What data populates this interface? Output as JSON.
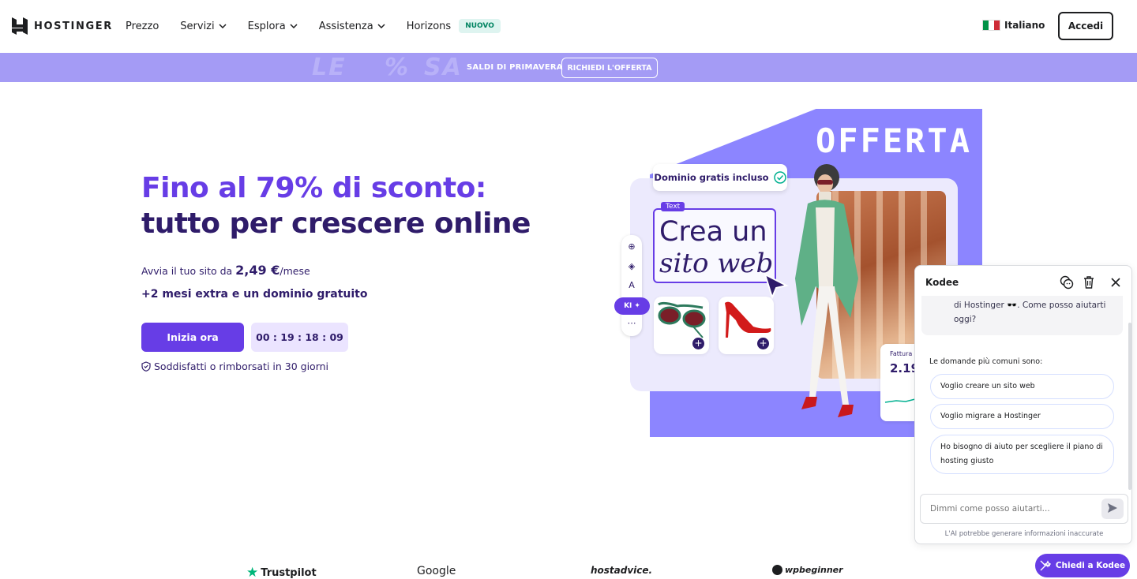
{
  "header": {
    "brand": "HOSTINGER",
    "nav": [
      {
        "label": "Prezzo",
        "dropdown": false
      },
      {
        "label": "Servizi",
        "dropdown": true
      },
      {
        "label": "Esplora",
        "dropdown": true
      },
      {
        "label": "Assistenza",
        "dropdown": true
      },
      {
        "label": "Horizons",
        "dropdown": false,
        "badge": "NUOVO"
      }
    ],
    "language": "Italiano",
    "login": "Accedi"
  },
  "promo": {
    "text": "SALDI DI PRIMAVERA",
    "cta": "RICHIEDI L'OFFERTA"
  },
  "hero": {
    "title_line1": "Fino al 79% di sconto:",
    "title_line2": "tutto per crescere online",
    "price_prefix": "Avvia il tuo sito da",
    "price": "2,49 €",
    "price_suffix": "/mese",
    "extra": "+2 mesi extra e un dominio gratuito",
    "cta": "Inizia ora",
    "timer": "00 : 19 : 18 : 09",
    "guarantee": "Soddisfatti o rimborsati in 30 giorni"
  },
  "illustration": {
    "offer_word": "OFFERTA",
    "domain_pill": "Dominio gratis incluso",
    "text_tag": "Text",
    "headline1": "Crea un",
    "headline2": "sito web",
    "ai_label": "KI",
    "invoice_label": "Fattura",
    "invoice_value": "2.19"
  },
  "chat": {
    "title": "Kodee",
    "message": "di Hostinger 🕶️. Come posso aiutarti oggi?",
    "faq_label": "Le domande più comuni sono:",
    "faq": [
      "Voglio creare un sito web",
      "Voglio migrare a Hostinger",
      "Ho bisogno di aiuto per scegliere il piano di hosting giusto"
    ],
    "input_placeholder": "Dimmi come posso aiutarti...",
    "disclaimer": "L'AI potrebbe generare informazioni inaccurate",
    "ask_button": "Chiedi a Kodee"
  },
  "reviews": [
    "Trustpilot",
    "Google",
    "hostadvice.",
    "wpbeginner"
  ],
  "colors": {
    "primary": "#673de6",
    "dark": "#2f1c6a",
    "promo": "#a49bf5",
    "illustration_purple": "#8c85ff"
  }
}
